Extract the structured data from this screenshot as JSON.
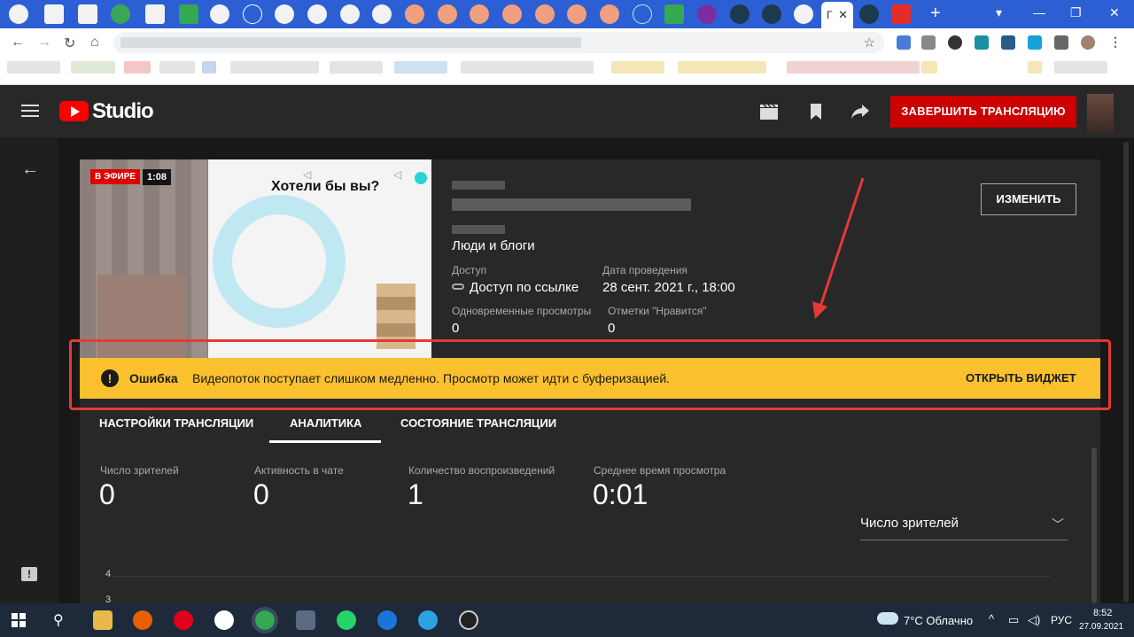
{
  "browser": {
    "active_tab_letter": "Г",
    "tab_close": "✕",
    "new_tab": "+",
    "window_controls": [
      "▾",
      "—",
      "❐",
      "✕"
    ],
    "nav": [
      "←",
      "→",
      "↻",
      "⌂"
    ],
    "star": "☆"
  },
  "header": {
    "logo_text": "Studio",
    "end_stream_label": "ЗАВЕРШИТЬ ТРАНСЛЯЦИЮ",
    "icons": [
      "clapper-icon",
      "bookmark-icon",
      "share-icon"
    ]
  },
  "preview": {
    "live_label": "В ЭФИРЕ",
    "live_time": "1:08",
    "overlay_text": "Хотели бы вы?"
  },
  "details": {
    "category_value": "Люди и блоги",
    "access_label": "Доступ",
    "access_value": "Доступ по ссылке",
    "date_label": "Дата проведения",
    "date_value": "28 сент. 2021 г., 18:00",
    "concurrent_label": "Одновременные просмотры",
    "concurrent_value": "0",
    "likes_label": "Отметки \"Нравится\"",
    "likes_value": "0",
    "edit_label": "ИЗМЕНИТЬ"
  },
  "alert": {
    "title": "Ошибка",
    "message": "Видеопоток поступает слишком медленно. Просмотр может идти с буферизацией.",
    "action": "ОТКРЫТЬ ВИДЖЕТ",
    "color": "#fbc02d"
  },
  "tabs": [
    {
      "label": "НАСТРОЙКИ ТРАНСЛЯЦИИ",
      "active": false
    },
    {
      "label": "АНАЛИТИКА",
      "active": true
    },
    {
      "label": "СОСТОЯНИЕ ТРАНСЛЯЦИИ",
      "active": false
    }
  ],
  "metrics": [
    {
      "label": "Число зрителей",
      "value": "0"
    },
    {
      "label": "Активность в чате",
      "value": "0"
    },
    {
      "label": "Количество воспроизведений",
      "value": "1"
    },
    {
      "label": "Среднее время просмотра",
      "value": "0:01"
    }
  ],
  "chart": {
    "dropdown_value": "Число зрителей",
    "y_ticks": [
      "4",
      "3"
    ]
  },
  "taskbar": {
    "weather": "7°C Облачно",
    "lang": "РУС",
    "time": "8:52",
    "date": "27.09.2021"
  },
  "colors": {
    "accent_red": "#cc0000",
    "annotation_red": "#e53935"
  }
}
